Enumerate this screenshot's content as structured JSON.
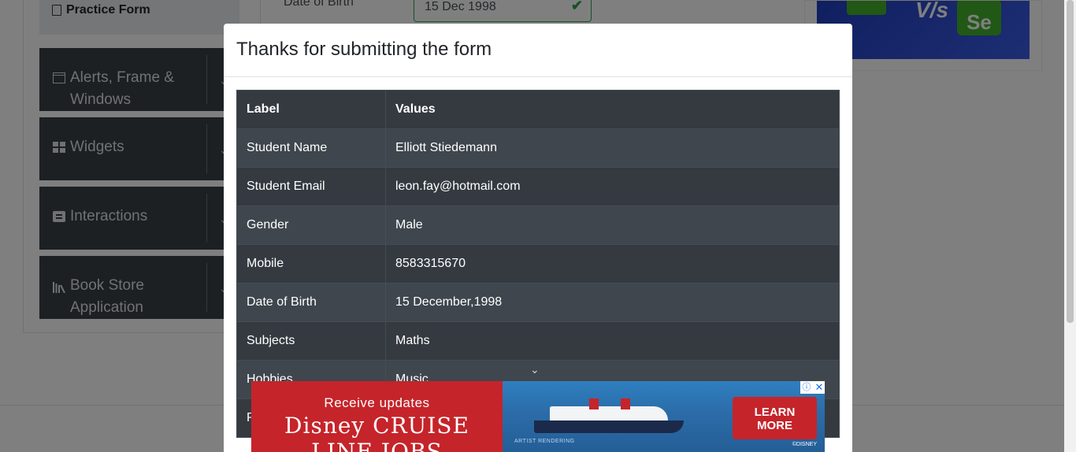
{
  "sidebar": {
    "practice_form": "Practice Form",
    "groups": [
      {
        "label_line1": "Alerts, Frame &",
        "label_line2": "Windows",
        "icon": "window-icon"
      },
      {
        "label_line1": "Widgets",
        "label_line2": "",
        "icon": "widgets-icon"
      },
      {
        "label_line1": "Interactions",
        "label_line2": "",
        "icon": "interactions-icon"
      },
      {
        "label_line1": "Book Store",
        "label_line2": "Application",
        "icon": "books-icon"
      }
    ]
  },
  "form": {
    "dob_label": "Date of Birth",
    "dob_value": "15 Dec 1998"
  },
  "banner": {
    "vs_text": "V/s",
    "se_text": "Se"
  },
  "modal": {
    "title": "Thanks for submitting the form",
    "columns": [
      "Label",
      "Values"
    ],
    "rows": [
      [
        "Student Name",
        "Elliott Stiedemann"
      ],
      [
        "Student Email",
        "leon.fay@hotmail.com"
      ],
      [
        "Gender",
        "Male"
      ],
      [
        "Mobile",
        "8583315670"
      ],
      [
        "Date of Birth",
        "15 December,1998"
      ],
      [
        "Subjects",
        "Maths"
      ],
      [
        "Hobbies",
        "Music"
      ],
      [
        "P",
        ""
      ]
    ]
  },
  "ad": {
    "line1": "Receive updates",
    "line2": "Disney CRUISE LINE JOBS",
    "cta_line1": "LEARN",
    "cta_line2": "MORE",
    "fine_print": "ARTIST RENDERING",
    "copyright": "©DISNEY",
    "brand_color": "#c5242a"
  }
}
